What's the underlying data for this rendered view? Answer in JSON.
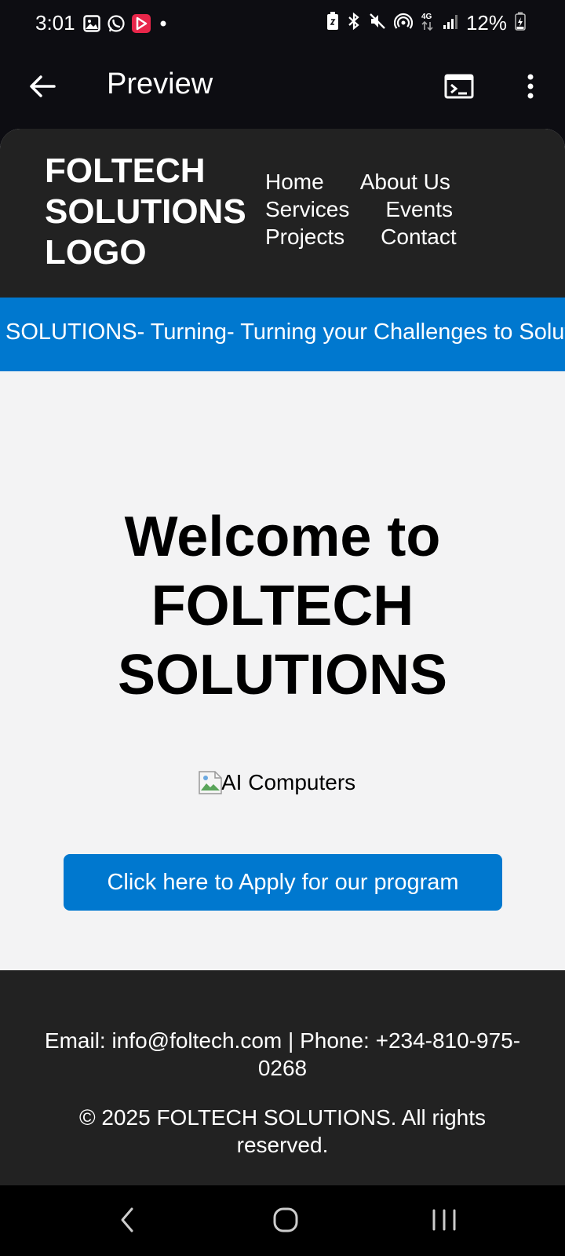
{
  "status_bar": {
    "time": "3:01",
    "battery_percent": "12%",
    "left_icons": [
      "gallery-icon",
      "whatsapp-icon",
      "app-notification-icon",
      "dot-icon"
    ],
    "right_icons": [
      "battery-saver-icon",
      "bluetooth-icon",
      "mute-icon",
      "hotspot-icon",
      "network-4g-icon",
      "signal-icon",
      "battery-charging-icon"
    ]
  },
  "app_bar": {
    "title": "Preview",
    "icons": [
      "back-arrow-icon",
      "terminal-icon",
      "more-vert-icon"
    ]
  },
  "site": {
    "logo": "FOLTECH SOLUTIONS LOGO",
    "nav": {
      "home": "Home",
      "about": "About Us",
      "services": "Services",
      "events": "Events",
      "projects": "Projects",
      "contact": "Contact"
    },
    "marquee": "SOLUTIONS- Turning- Turning your Challenges to Solutions",
    "hero_title": "Welcome to FOLTECH SOLUTIONS",
    "hero_image_alt": "AI Computers",
    "apply_button": "Click here to Apply for our program",
    "footer": {
      "contact": "Email: info@foltech.com | Phone: +234-810-975-0268",
      "copyright": "© 2025 FOLTECH SOLUTIONS. All rights reserved."
    }
  },
  "system_nav": {
    "icons": [
      "nav-back-icon",
      "nav-home-icon",
      "nav-recents-icon"
    ]
  },
  "colors": {
    "brand_blue": "#0078cf",
    "header_dark": "#222222",
    "page_bg": "#f3f3f4",
    "app_bar_bg": "#0d0d12"
  }
}
